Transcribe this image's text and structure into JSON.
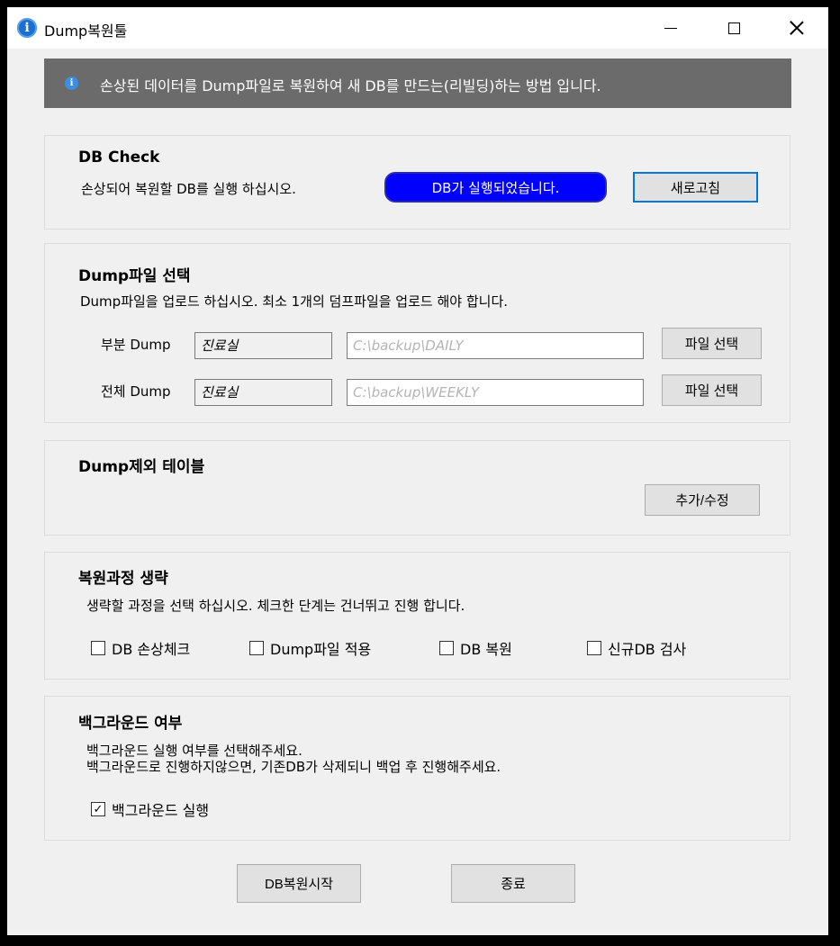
{
  "window": {
    "title": "Dump복원툴",
    "icon": "info-icon"
  },
  "banner": {
    "icon": "info-icon",
    "text": "손상된 데이터를 Dump파일로 복원하여 새 DB를 만드는(리빌딩)하는 방법 입니다."
  },
  "db_check": {
    "title": "DB Check",
    "desc": "손상되어 복원할 DB를 실행 하십시오.",
    "status": "DB가 실행되었습니다.",
    "status_color": "#0000ff",
    "refresh_label": "새로고침"
  },
  "dump_select": {
    "title": "Dump파일 선택",
    "desc": "Dump파일을 업로드 하십시오. 최소 1개의 덤프파일을 업로드 해야 합니다.",
    "rows": [
      {
        "label": "부분 Dump",
        "name": "진료실",
        "path": "C:\\backup\\DAILY",
        "button": "파일 선택"
      },
      {
        "label": "전체 Dump",
        "name": "진료실",
        "path": "C:\\backup\\WEEKLY",
        "button": "파일 선택"
      }
    ]
  },
  "exclude_tables": {
    "title": "Dump제외 테이블",
    "button": "추가/수정"
  },
  "skip_steps": {
    "title": "복원과정 생략",
    "desc": "생략할 과정을 선택 하십시오. 체크한 단계는 건너뛰고 진행 합니다.",
    "options": [
      {
        "label": "DB 손상체크",
        "checked": false
      },
      {
        "label": "Dump파일 적용",
        "checked": false
      },
      {
        "label": "DB 복원",
        "checked": false
      },
      {
        "label": "신규DB 검사",
        "checked": false
      }
    ]
  },
  "background": {
    "title": "백그라운드 여부",
    "desc1": "백그라운드 실행 여부를 선택해주세요.",
    "desc2": "백그라운드로 진행하지않으면, 기존DB가 삭제되니 백업 후 진행해주세요.",
    "option": {
      "label": "백그라운드 실행",
      "checked": true
    }
  },
  "footer": {
    "start_label": "DB복원시작",
    "exit_label": "종료"
  }
}
